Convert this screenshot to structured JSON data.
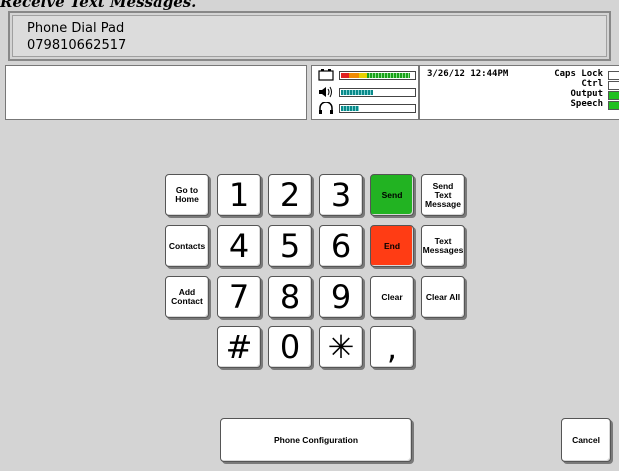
{
  "page_title": "Receive Text Messages.",
  "phone_panel": {
    "title": "Phone Dial Pad",
    "number": "079810662517"
  },
  "message_box": {
    "text": ""
  },
  "meters": [
    {
      "icon": "battery-icon",
      "level": 0.95
    },
    {
      "icon": "speaker-icon",
      "level": 0.45
    },
    {
      "icon": "headphones-icon",
      "level": 0.25
    }
  ],
  "status_bar": {
    "datetime": "3/26/12 12:44PM",
    "caps_lock": "Caps Lock",
    "ctrl": "Ctrl",
    "output": "Output",
    "speech": "Speech"
  },
  "keypad": {
    "go_home": "Go to\nHome",
    "contacts": "Contacts",
    "add_contact": "Add\nContact",
    "digits": [
      "1",
      "2",
      "3",
      "4",
      "5",
      "6",
      "7",
      "8",
      "9",
      "#",
      "0",
      "✳",
      ","
    ],
    "send": "Send",
    "end": "End",
    "clear": "Clear",
    "send_text": "Send\nText\nMessage",
    "text_messages": "Text\nMessages",
    "clear_all": "Clear All"
  },
  "footer": {
    "phone_config": "Phone Configuration",
    "cancel": "Cancel"
  },
  "colors": {
    "send": "#22b322",
    "end": "#ff3c14",
    "background": "#d4d4d4"
  }
}
